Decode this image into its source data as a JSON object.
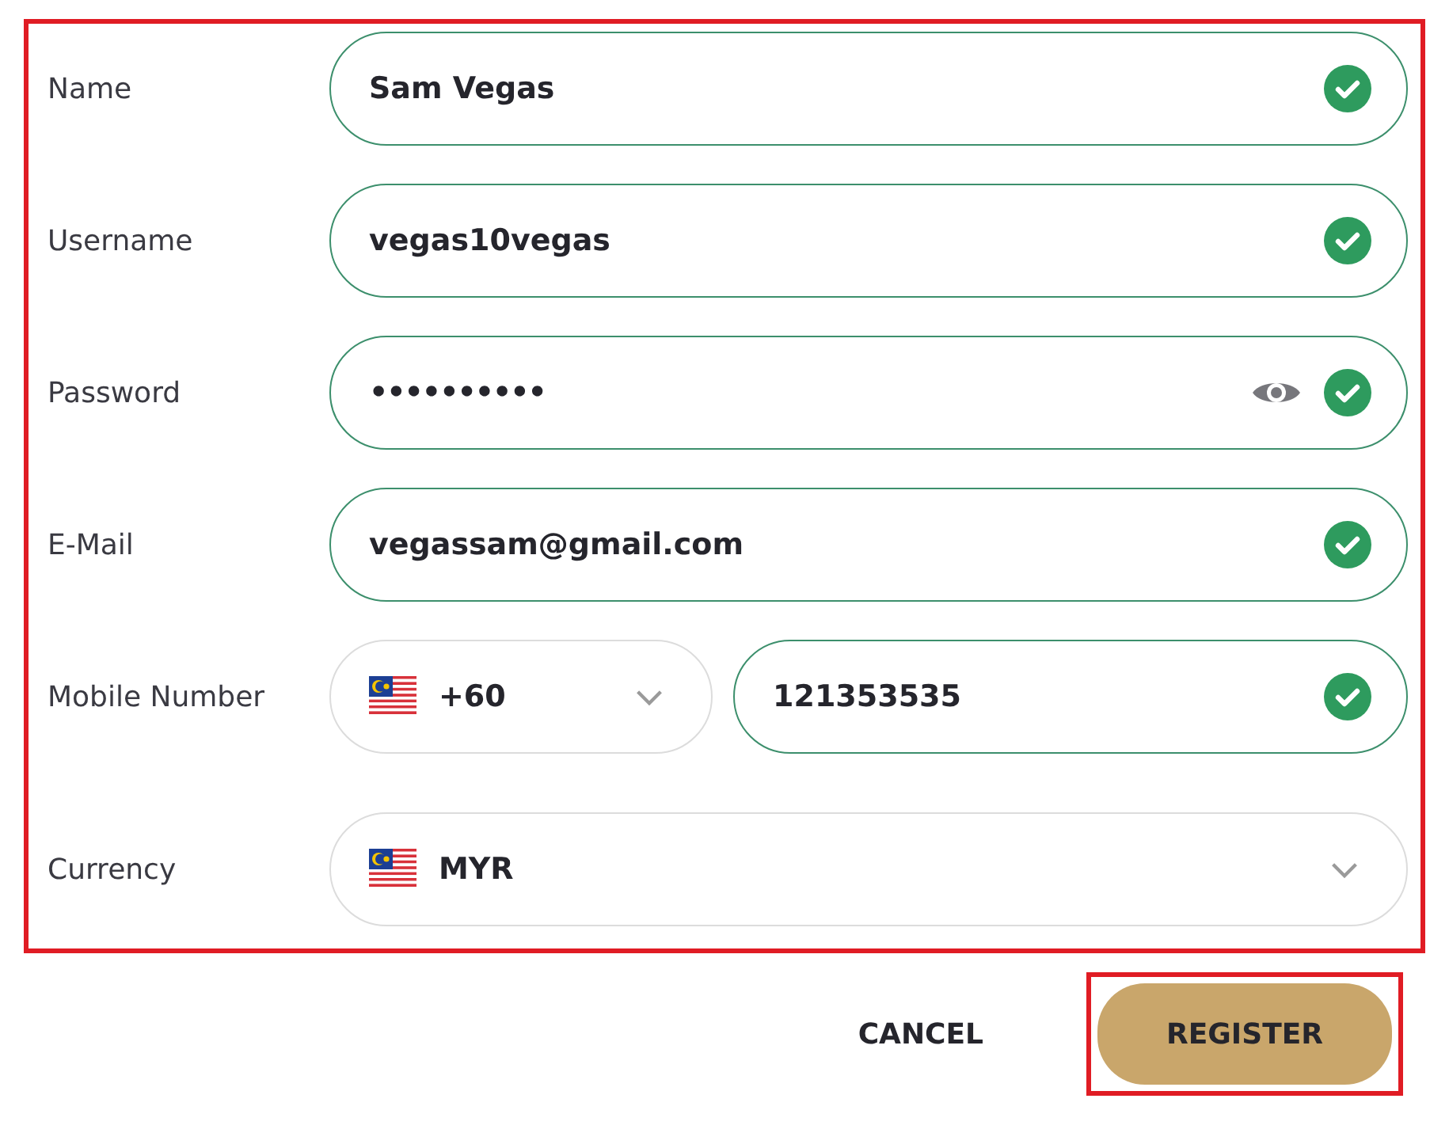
{
  "form": {
    "highlighted": true,
    "fields": [
      {
        "kind": "text",
        "label": "Name",
        "value": "Sam Vegas",
        "valid": true
      },
      {
        "kind": "text",
        "label": "Username",
        "value": "vegas10vegas",
        "valid": true
      },
      {
        "kind": "password",
        "label": "Password",
        "value": "••••••••••",
        "valid": true
      },
      {
        "kind": "text",
        "label": "E-Mail",
        "value": "vegassam@gmail.com",
        "valid": true
      },
      {
        "kind": "phone",
        "label": "Mobile Number",
        "code": "+60",
        "value": "121353535",
        "valid": true
      },
      {
        "kind": "select",
        "label": "Currency",
        "value": "MYR",
        "valid": false
      }
    ]
  },
  "buttons": [
    {
      "kind": "text",
      "label": "CANCEL",
      "highlighted": false
    },
    {
      "kind": "primary",
      "label": "REGISTER",
      "highlighted": true
    }
  ]
}
